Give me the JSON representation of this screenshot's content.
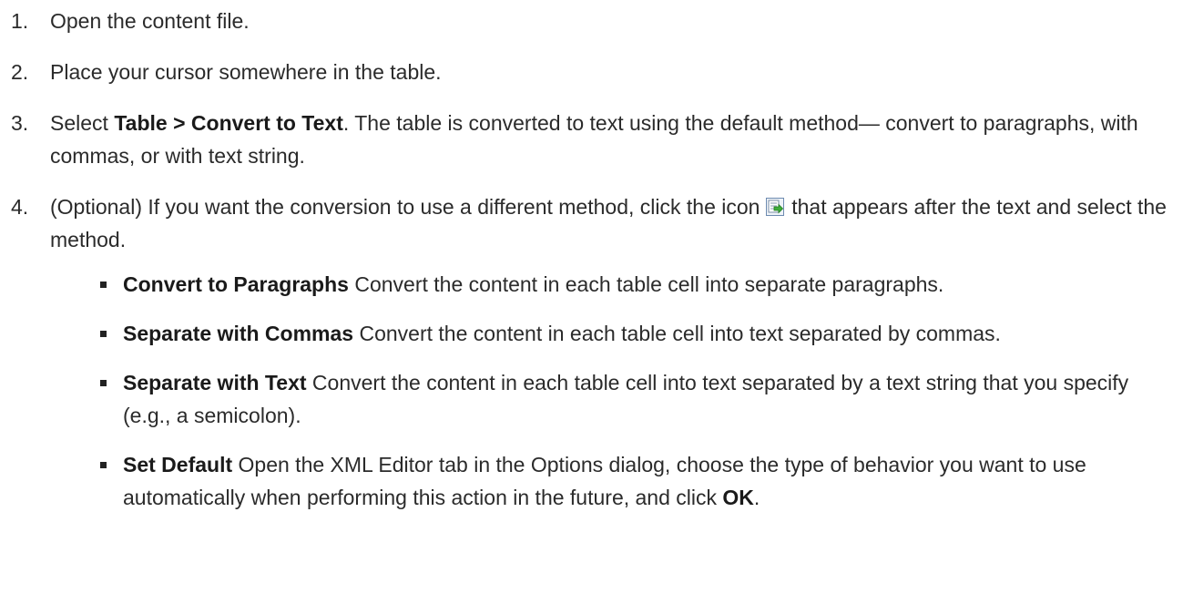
{
  "steps": [
    {
      "num": "1.",
      "text": "Open the content file."
    },
    {
      "num": "2.",
      "text": "Place your cursor somewhere in the table."
    },
    {
      "num": "3.",
      "pre": "Select ",
      "bold": "Table > Convert to Text",
      "post": ". The table is converted to text using the default method— convert to paragraphs, with commas, or with text string."
    },
    {
      "num": "4.",
      "pre": "(Optional) If you want the conversion to use a different method, click the icon ",
      "icon": "convert-options-icon",
      "post": " that appears after the text and select the method.",
      "bullets": [
        {
          "bold": "Convert to Paragraphs",
          "text": " Convert the content in each table cell into separate paragraphs."
        },
        {
          "bold": "Separate with Commas",
          "text": " Convert the content in each table cell into text separated by commas."
        },
        {
          "bold": "Separate with Text",
          "text": " Convert the content in each table cell into text separated by a text string that you specify (e.g., a semicolon)."
        },
        {
          "bold": "Set Default",
          "text": " Open the XML Editor tab in the Options dialog, choose the type of behavior you want to use automatically when performing this action in the future, and click ",
          "bold_end": "OK",
          "end": "."
        }
      ]
    }
  ]
}
